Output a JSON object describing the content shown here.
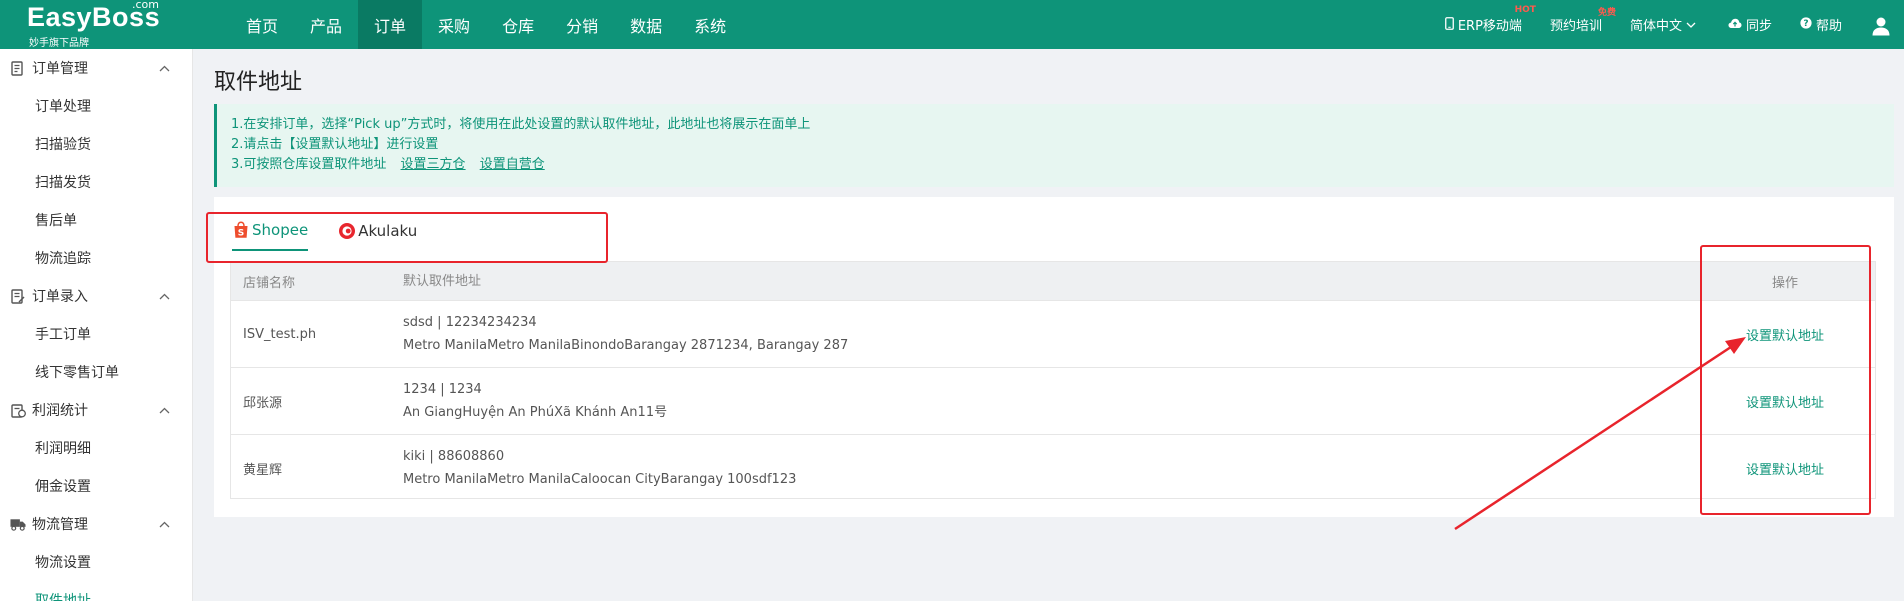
{
  "brand": {
    "name": "EasyBoss",
    "com": ".com",
    "sub": "妙手旗下品牌"
  },
  "nav": [
    "首页",
    "产品",
    "订单",
    "采购",
    "仓库",
    "分销",
    "数据",
    "系统"
  ],
  "nav_active": 2,
  "top_right": {
    "erp_mobile": "ERP移动端",
    "erp_badge": "HOT",
    "training": "预约培训",
    "training_badge": "免费",
    "language": "简体中文",
    "sync": "同步",
    "help": "帮助"
  },
  "sidebar": [
    {
      "group": "订单管理",
      "items": [
        "订单处理",
        "扫描验货",
        "扫描发货",
        "售后单",
        "物流追踪"
      ]
    },
    {
      "group": "订单录入",
      "items": [
        "手工订单",
        "线下零售订单"
      ]
    },
    {
      "group": "利润统计",
      "items": [
        "利润明细",
        "佣金设置"
      ]
    },
    {
      "group": "物流管理",
      "items": [
        "物流设置",
        "取件地址"
      ]
    }
  ],
  "page_title": "取件地址",
  "notice": {
    "line1": "1.在安排订单，选择“Pick up”方式时，将使用在此处设置的默认取件地址，此地址也将展示在面单上",
    "line2": "2.请点击【设置默认地址】进行设置",
    "line3": "3.可按照仓库设置取件地址",
    "link1": "设置三方仓",
    "link2": "设置自营仓"
  },
  "tabs": [
    "Shopee",
    "Akulaku"
  ],
  "table": {
    "headers": {
      "shop": "店铺名称",
      "address": "默认取件地址",
      "operation": "操作"
    },
    "rows": [
      {
        "shop": "ISV_test.ph",
        "contact": "sdsd | 12234234234",
        "address": "Metro ManilaMetro ManilaBinondoBarangay 2871234, Barangay 287",
        "action": "设置默认地址"
      },
      {
        "shop": "邱张源",
        "contact": "1234 | 1234",
        "address": "An GiangHuyện An PhúXã Khánh An11号",
        "action": "设置默认地址"
      },
      {
        "shop": "黄星辉",
        "contact": "kiki | 88608860",
        "address": "Metro ManilaMetro ManilaCaloocan CityBarangay 100sdf123",
        "action": "设置默认地址"
      }
    ]
  },
  "colors": {
    "primary": "#0e9479",
    "annotation": "#e8242c",
    "notice_bg": "#e7f6f1"
  }
}
